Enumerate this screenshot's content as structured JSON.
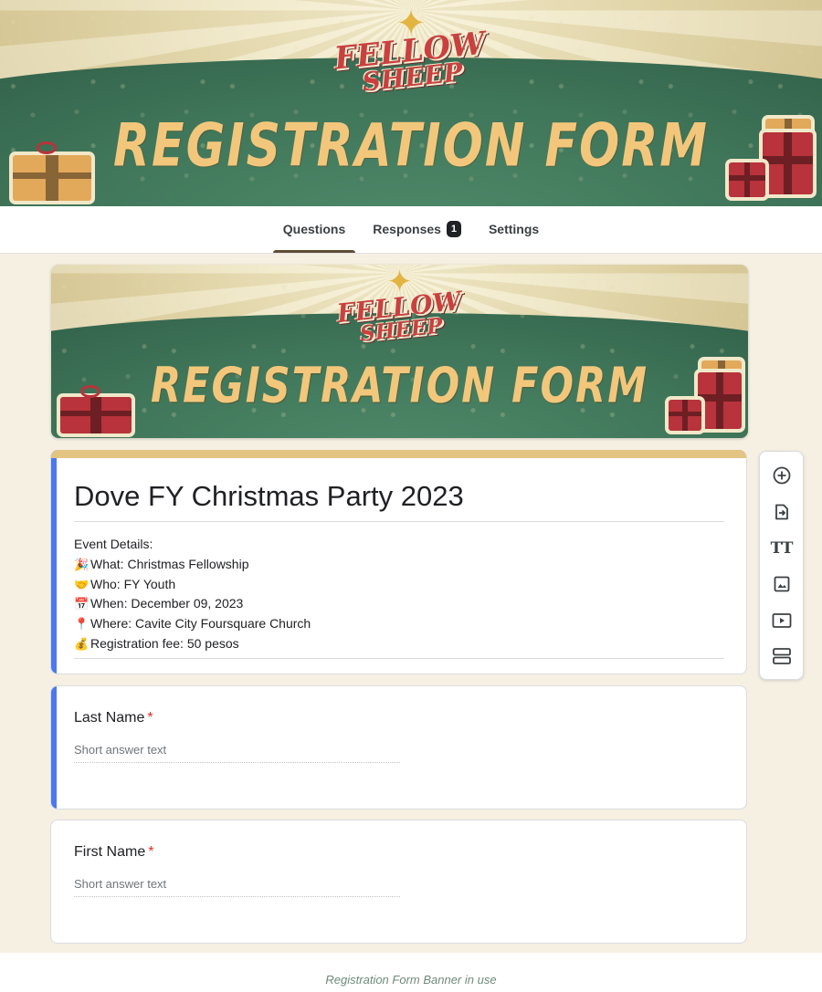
{
  "banner": {
    "logo_line1": "FELLOW",
    "logo_line2": "SHEEP",
    "title": "REGISTRATION FORM"
  },
  "tabs": [
    {
      "label": "Questions",
      "active": true
    },
    {
      "label": "Responses",
      "badge": "1"
    },
    {
      "label": "Settings"
    }
  ],
  "form": {
    "title": "Dove FY Christmas Party 2023",
    "description": [
      {
        "emoji": "",
        "text": "Event Details:"
      },
      {
        "emoji": "🎉",
        "text": "What: Christmas Fellowship"
      },
      {
        "emoji": "🤝",
        "text": "Who: FY Youth"
      },
      {
        "emoji": "📅",
        "text": "When: December 09, 2023"
      },
      {
        "emoji": "📍",
        "text": "Where: Cavite City Foursquare Church"
      },
      {
        "emoji": "💰",
        "text": "Registration fee: 50 pesos"
      }
    ]
  },
  "questions": [
    {
      "label": "Last Name",
      "required_mark": "*",
      "placeholder": "Short answer text"
    },
    {
      "label": "First Name",
      "required_mark": "*",
      "placeholder": "Short answer text"
    }
  ],
  "toolbar": [
    {
      "icon": "add-circle-icon"
    },
    {
      "icon": "import-questions-icon"
    },
    {
      "icon": "add-title-icon",
      "glyph": "TT"
    },
    {
      "icon": "add-image-icon"
    },
    {
      "icon": "add-video-icon"
    },
    {
      "icon": "add-section-icon"
    }
  ],
  "colors": {
    "accent_bar": "#e2c483",
    "focus_bar": "#4b78f0",
    "page_bg": "#f6f0e3",
    "tab_indicator": "#5e4d35",
    "required": "#d93025"
  },
  "caption": "Registration Form Banner in use"
}
